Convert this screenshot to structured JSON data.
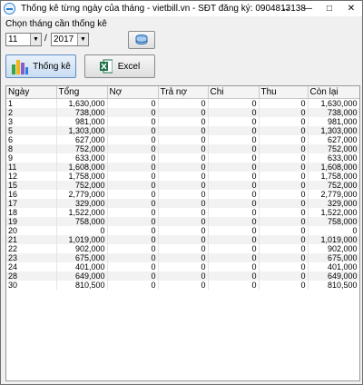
{
  "window": {
    "title": "Thống kê từng ngày của tháng - vietbill.vn - SĐT đăng ký: 0904813138",
    "controls": {
      "minimize": "—",
      "resize": "↔",
      "maximize": "□",
      "close": "✕"
    }
  },
  "filter": {
    "label": "Chọn tháng cần thống kê",
    "month": "11",
    "separator": "/",
    "year": "2017"
  },
  "buttons": {
    "statistics": "Thống kê",
    "excel": "Excel"
  },
  "table": {
    "columns": [
      "Ngày",
      "Tổng",
      "Nợ",
      "Trả nợ",
      "Chi",
      "Thu",
      "Còn lại"
    ],
    "rows": [
      [
        "1",
        "1,630,000",
        "0",
        "0",
        "0",
        "0",
        "1,630,000"
      ],
      [
        "2",
        "738,000",
        "0",
        "0",
        "0",
        "0",
        "738,000"
      ],
      [
        "3",
        "981,000",
        "0",
        "0",
        "0",
        "0",
        "981,000"
      ],
      [
        "5",
        "1,303,000",
        "0",
        "0",
        "0",
        "0",
        "1,303,000"
      ],
      [
        "6",
        "627,000",
        "0",
        "0",
        "0",
        "0",
        "627,000"
      ],
      [
        "8",
        "752,000",
        "0",
        "0",
        "0",
        "0",
        "752,000"
      ],
      [
        "9",
        "633,000",
        "0",
        "0",
        "0",
        "0",
        "633,000"
      ],
      [
        "11",
        "1,608,000",
        "0",
        "0",
        "0",
        "0",
        "1,608,000"
      ],
      [
        "12",
        "1,758,000",
        "0",
        "0",
        "0",
        "0",
        "1,758,000"
      ],
      [
        "15",
        "752,000",
        "0",
        "0",
        "0",
        "0",
        "752,000"
      ],
      [
        "16",
        "2,779,000",
        "0",
        "0",
        "0",
        "0",
        "2,779,000"
      ],
      [
        "17",
        "329,000",
        "0",
        "0",
        "0",
        "0",
        "329,000"
      ],
      [
        "18",
        "1,522,000",
        "0",
        "0",
        "0",
        "0",
        "1,522,000"
      ],
      [
        "19",
        "758,000",
        "0",
        "0",
        "0",
        "0",
        "758,000"
      ],
      [
        "20",
        "0",
        "0",
        "0",
        "0",
        "0",
        "0"
      ],
      [
        "21",
        "1,019,000",
        "0",
        "0",
        "0",
        "0",
        "1,019,000"
      ],
      [
        "22",
        "902,000",
        "0",
        "0",
        "0",
        "0",
        "902,000"
      ],
      [
        "23",
        "675,000",
        "0",
        "0",
        "0",
        "0",
        "675,000"
      ],
      [
        "24",
        "401,000",
        "0",
        "0",
        "0",
        "0",
        "401,000"
      ],
      [
        "28",
        "649,000",
        "0",
        "0",
        "0",
        "0",
        "649,000"
      ],
      [
        "30",
        "810,500",
        "0",
        "0",
        "0",
        "0",
        "810,500"
      ]
    ]
  }
}
